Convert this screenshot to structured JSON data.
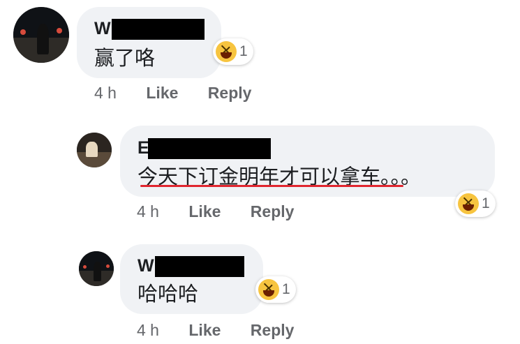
{
  "comments": [
    {
      "author_initial": "W",
      "text": "赢了咯",
      "reaction": {
        "icon": "laughing-face-icon",
        "count": "1"
      },
      "time": "4 h",
      "like_label": "Like",
      "reply_label": "Reply"
    },
    {
      "author_initial": "E",
      "text": "今天下订金明年才可以拿车。。。",
      "reaction": {
        "icon": "laughing-face-icon",
        "count": "1"
      },
      "time": "4 h",
      "like_label": "Like",
      "reply_label": "Reply"
    },
    {
      "author_initial": "W",
      "text": "哈哈哈",
      "reaction": {
        "icon": "laughing-face-icon",
        "count": "1"
      },
      "time": "4 h",
      "like_label": "Like",
      "reply_label": "Reply"
    }
  ],
  "colors": {
    "bubble": "#f0f2f5",
    "meta": "#65676b",
    "underline": "#e0262f",
    "emoji": "#f7c43f"
  }
}
